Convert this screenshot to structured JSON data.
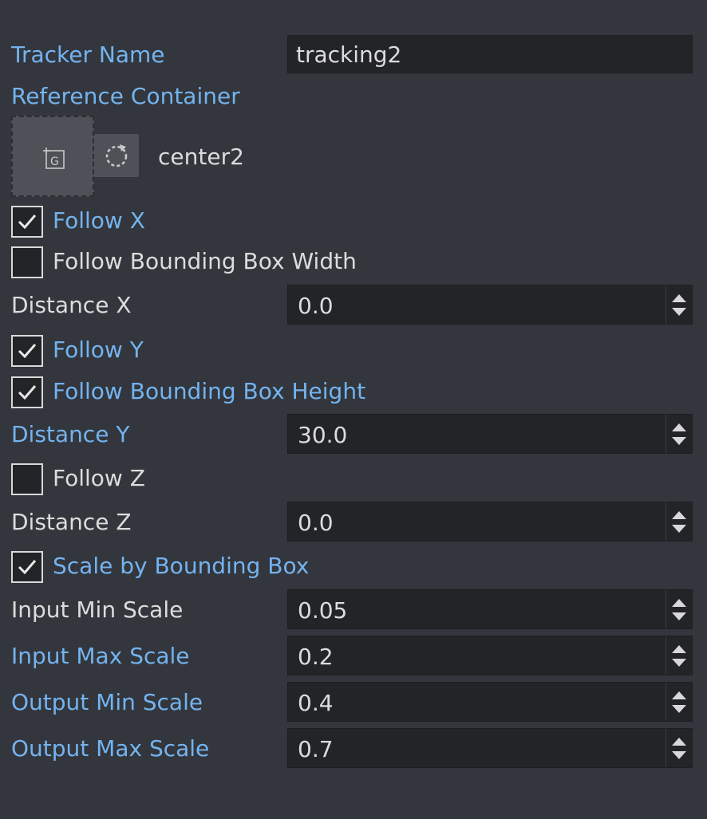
{
  "tracker_name": {
    "label": "Tracker Name",
    "value": "tracking2"
  },
  "reference_container": {
    "label": "Reference Container",
    "drop_icon": "add-group-icon",
    "drop_icon_glyph": "G",
    "reset_icon": "reset-icon",
    "value": "center2"
  },
  "follow_x": {
    "label": "Follow X",
    "checked": true
  },
  "follow_bbox_width": {
    "label": "Follow Bounding Box Width",
    "checked": false
  },
  "distance_x": {
    "label": "Distance X",
    "value": "0.0"
  },
  "follow_y": {
    "label": "Follow Y",
    "checked": true
  },
  "follow_bbox_height": {
    "label": "Follow Bounding Box Height",
    "checked": true
  },
  "distance_y": {
    "label": "Distance Y",
    "value": "30.0"
  },
  "follow_z": {
    "label": "Follow Z",
    "checked": false
  },
  "distance_z": {
    "label": "Distance Z",
    "value": "0.0"
  },
  "scale_by_bbox": {
    "label": "Scale by Bounding Box",
    "checked": true
  },
  "input_min_scale": {
    "label": "Input Min Scale",
    "value": "0.05"
  },
  "input_max_scale": {
    "label": "Input Max Scale",
    "value": "0.2"
  },
  "output_min_scale": {
    "label": "Output Min Scale",
    "value": "0.4"
  },
  "output_max_scale": {
    "label": "Output Max Scale",
    "value": "0.7"
  },
  "colors": {
    "background": "#33363c",
    "field_background": "#222428",
    "accent_label": "#74b3f0",
    "plain_label": "#dcdcdc",
    "button_background": "#4e5157"
  }
}
